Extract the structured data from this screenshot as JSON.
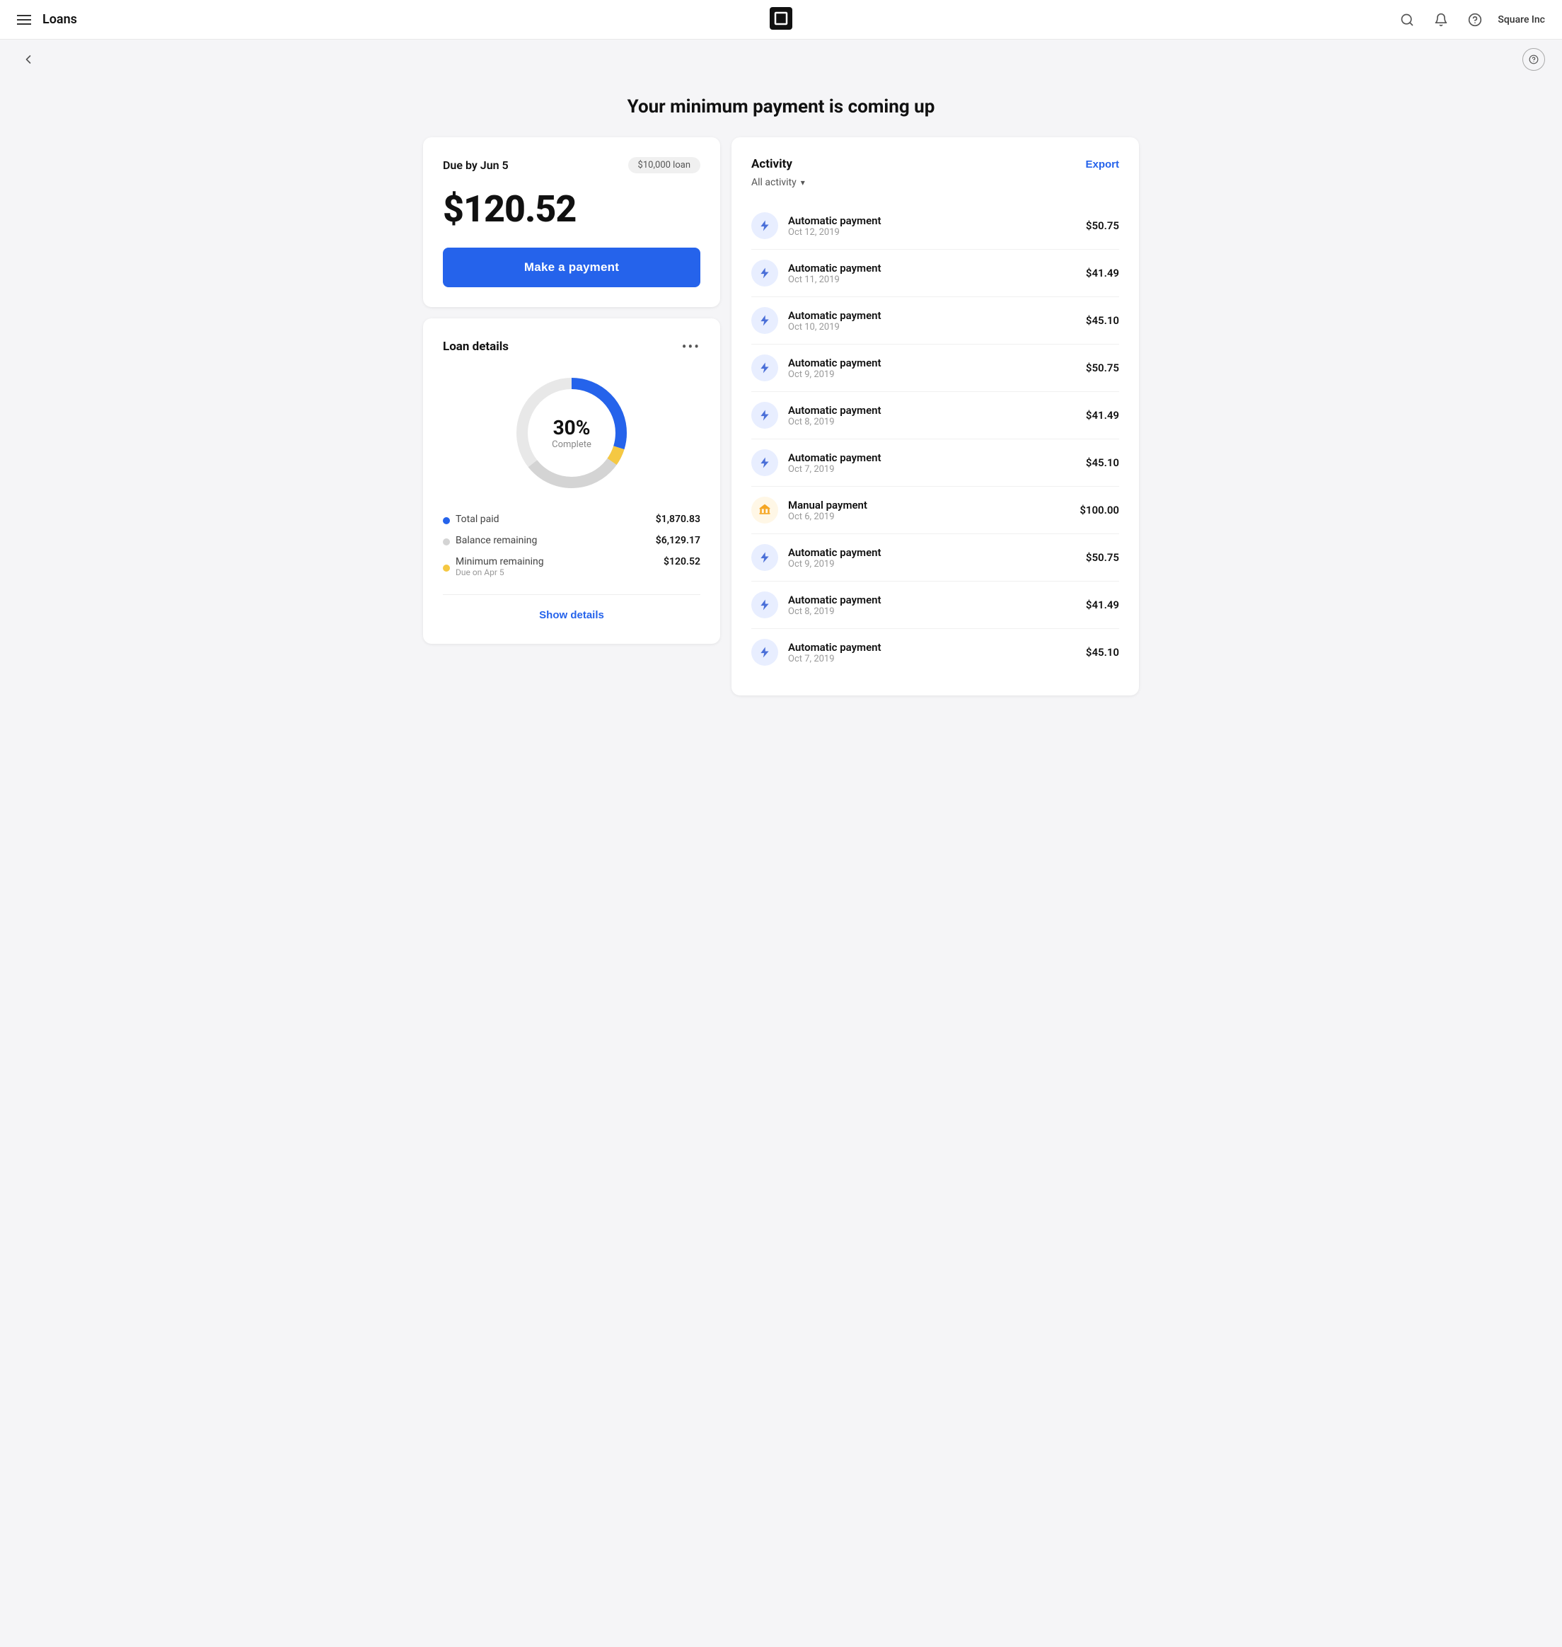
{
  "header": {
    "menu_icon": "menu",
    "title": "Loans",
    "logo_alt": "Square logo",
    "search_icon": "search",
    "notification_icon": "bell",
    "help_icon": "help-circle",
    "user_name": "Square Inc"
  },
  "sub_header": {
    "back_icon": "chevron-left",
    "help_icon": "question-mark"
  },
  "page": {
    "title": "Your minimum payment is coming up"
  },
  "payment_card": {
    "due_label": "Due by Jun 5",
    "loan_badge": "$10,000 loan",
    "amount": "$120.52",
    "make_payment_label": "Make a payment"
  },
  "loan_details_card": {
    "title": "Loan details",
    "more_icon": "...",
    "chart": {
      "percent": "30%",
      "label": "Complete",
      "total_paid_pct": 30,
      "min_remaining_pct": 5,
      "balance_pct": 65
    },
    "legend": [
      {
        "color": "#2563eb",
        "label": "Total paid",
        "value": "$1,870.83"
      },
      {
        "color": "#d4d4d4",
        "label": "Balance remaining",
        "value": "$6,129.17"
      },
      {
        "color": "#f5c842",
        "label": "Minimum remaining",
        "sub": "Due on Apr 5",
        "value": "$120.52"
      }
    ],
    "show_details_label": "Show details"
  },
  "activity": {
    "title": "Activity",
    "export_label": "Export",
    "filter_label": "All activity",
    "filter_arrow": "▾",
    "items": [
      {
        "type": "auto",
        "name": "Automatic payment",
        "date": "Oct 12, 2019",
        "amount": "$50.75"
      },
      {
        "type": "auto",
        "name": "Automatic payment",
        "date": "Oct 11, 2019",
        "amount": "$41.49"
      },
      {
        "type": "auto",
        "name": "Automatic payment",
        "date": "Oct 10, 2019",
        "amount": "$45.10"
      },
      {
        "type": "auto",
        "name": "Automatic payment",
        "date": "Oct 9, 2019",
        "amount": "$50.75"
      },
      {
        "type": "auto",
        "name": "Automatic payment",
        "date": "Oct 8, 2019",
        "amount": "$41.49"
      },
      {
        "type": "auto",
        "name": "Automatic payment",
        "date": "Oct 7, 2019",
        "amount": "$45.10"
      },
      {
        "type": "manual",
        "name": "Manual payment",
        "date": "Oct 6, 2019",
        "amount": "$100.00"
      },
      {
        "type": "auto",
        "name": "Automatic payment",
        "date": "Oct 9, 2019",
        "amount": "$50.75"
      },
      {
        "type": "auto",
        "name": "Automatic payment",
        "date": "Oct 8, 2019",
        "amount": "$41.49"
      },
      {
        "type": "auto",
        "name": "Automatic payment",
        "date": "Oct 7, 2019",
        "amount": "$45.10"
      }
    ]
  },
  "colors": {
    "blue": "#2563eb",
    "gray": "#d4d4d4",
    "yellow": "#f5c842",
    "bg": "#f5f5f7"
  }
}
